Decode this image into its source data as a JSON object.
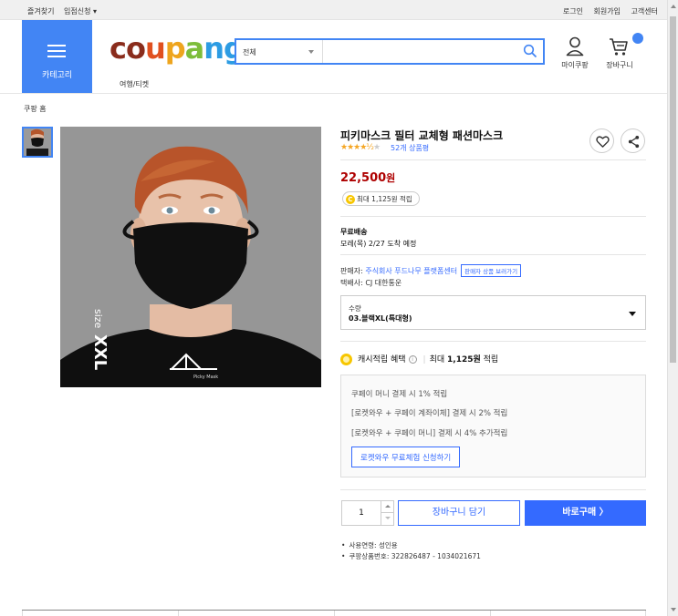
{
  "topbar": {
    "left": [
      "즐겨찾기",
      "입점신청 ▾"
    ],
    "right": [
      "로그인",
      "회원가입",
      "고객센터"
    ]
  },
  "header": {
    "category_label": "카테고리",
    "logo_text": [
      "c",
      "o",
      "u",
      "p",
      "a",
      "n",
      "g"
    ],
    "search": {
      "scope": "전체",
      "placeholder": "",
      "value": ""
    },
    "mypage_label": "마이쿠팡",
    "cart_label": "장바구니",
    "subnav": "여행/티켓",
    "brand_color": "#4285f4"
  },
  "breadcrumb": "쿠팡 홈",
  "product": {
    "title": "피키마스크 필터 교체형 패션마스크",
    "rating_stars": "★★★★",
    "rating_half": "½",
    "rating_off": "★",
    "review_count": "52개 상품평",
    "price": "22,500",
    "price_unit": "원",
    "cash_pill": "최대 1,125원 적립",
    "shipping_title": "무료배송",
    "shipping_eta": "모레(목) 2/27 도착 예정",
    "seller_label": "판매자: ",
    "seller_name": "주식회사 푸드나무 플랫폼센터",
    "seller_tag": "판매자 상품 보러가기",
    "courier": "택배사: CJ 대한통운",
    "option_label": "수량",
    "option_value": "03.블랙XL(특대형)",
    "image_text_size": "size",
    "image_text_xxl": "XXL",
    "image_logo_caption": "Picky Mask"
  },
  "cash_benefit": {
    "title": "캐시적립 혜택",
    "info_icon": "i",
    "divider": "|",
    "amount_prefix": "최대",
    "amount": "1,125원",
    "amount_suffix": "적립",
    "lines": [
      "쿠페이 머니 결제 시 1% 적립",
      "[로켓와우 + 쿠페이 계좌이체] 결제 시 2% 적립",
      "[로켓와우 + 쿠페이 머니] 결제 시 4% 추가적립"
    ],
    "trial_button": "로켓와우 무료체험 신청하기"
  },
  "purchase": {
    "quantity": "1",
    "cart_button": "장바구니 담기",
    "buy_button": "바로구매 〉"
  },
  "meta": [
    "사용연령: 성인용",
    "쿠팡상품번호: 322826487 - 1034021671"
  ],
  "colors": {
    "price": "#ae0000",
    "link": "#346aff",
    "star": "#f5a623",
    "coin": "#f7c600"
  }
}
